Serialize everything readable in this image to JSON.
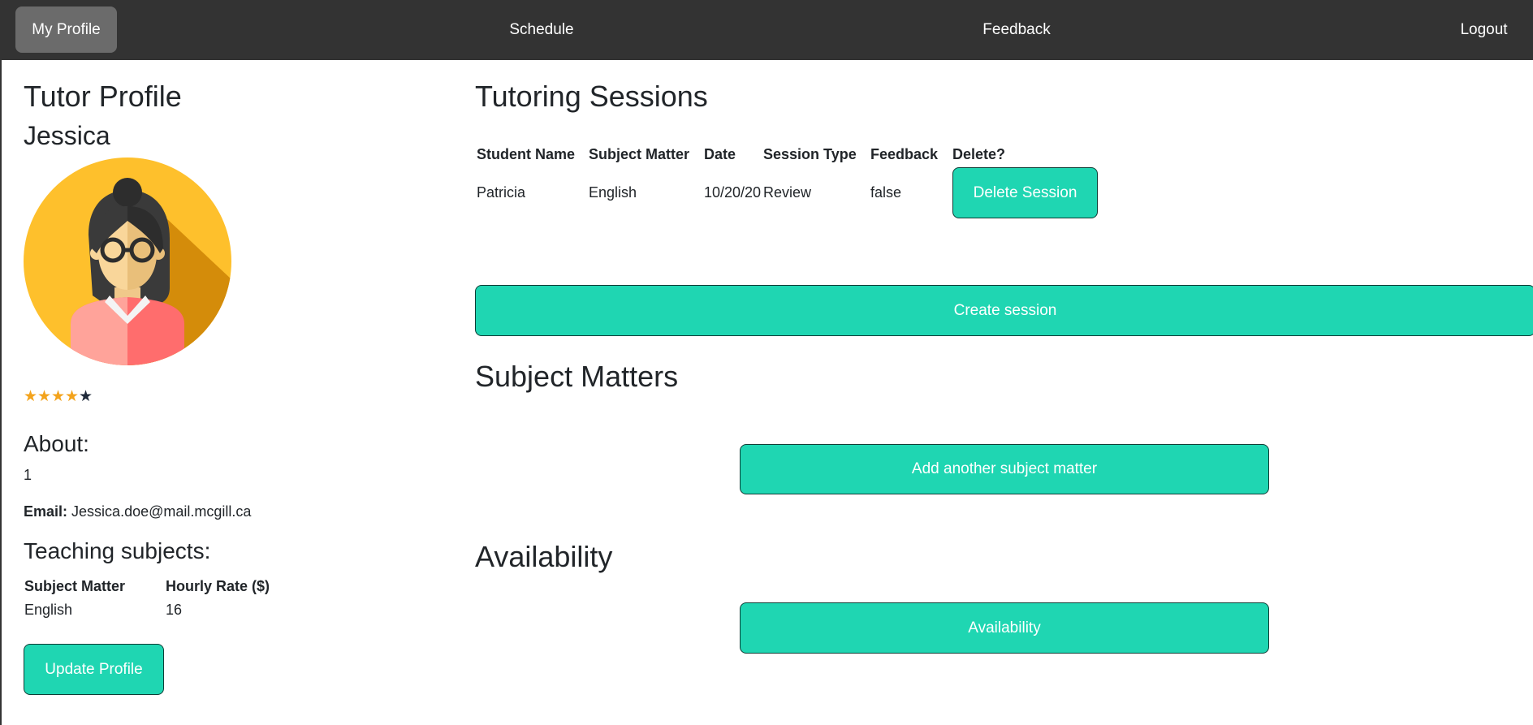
{
  "nav": {
    "profile": "My Profile",
    "schedule": "Schedule",
    "feedback": "Feedback",
    "logout": "Logout"
  },
  "profile": {
    "title": "Tutor Profile",
    "name": "Jessica",
    "rating": {
      "filled": 4,
      "total": 5
    },
    "about_heading": "About:",
    "about_value": "1",
    "email_label": "Email:",
    "email_value": "Jessica.doe@mail.mcgill.ca",
    "subjects_heading": "Teaching subjects:",
    "subjects_columns": [
      "Subject Matter",
      "Hourly Rate ($)"
    ],
    "subjects_rows": [
      [
        "English",
        "16"
      ]
    ],
    "update_button": "Update Profile"
  },
  "sessions": {
    "title": "Tutoring Sessions",
    "columns": [
      "Student Name",
      "Subject Matter",
      "Date",
      "Session Type",
      "Feedback",
      "Delete?"
    ],
    "rows": [
      {
        "student": "Patricia",
        "subject": "English",
        "date": "10/20/20",
        "type": "Review",
        "feedback": "false",
        "delete_label": "Delete Session"
      }
    ],
    "create_button": "Create session"
  },
  "subject_matters": {
    "title": "Subject Matters",
    "add_button": "Add another subject matter"
  },
  "availability": {
    "title": "Availability",
    "button": "Availability"
  },
  "colors": {
    "navbar": "#333333",
    "nav_active": "#6b6b6b",
    "accent": "#1fd6b2",
    "star_filled": "#f3a31c",
    "star_empty": "#1f2a3a"
  }
}
